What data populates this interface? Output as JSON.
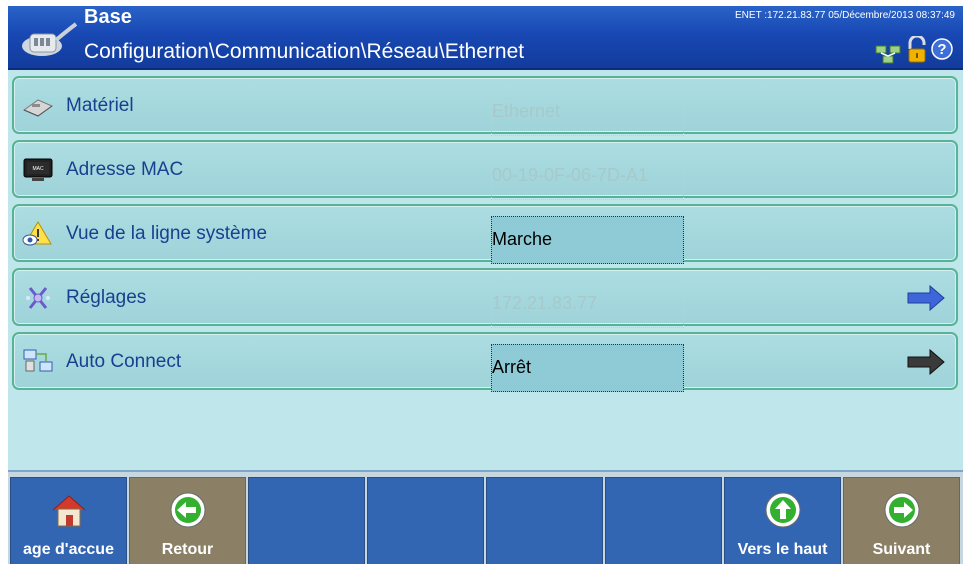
{
  "header": {
    "title": "Base",
    "path": "Configuration\\Communication\\Réseau\\Ethernet",
    "status": "ENET :172.21.83.77  05/Décembre/2013 08:37:49",
    "icons": [
      "network-icon",
      "lock-icon",
      "help-icon"
    ]
  },
  "rows": [
    {
      "label": "Matériel",
      "value": "Ethernet",
      "icon": "hardware-icon",
      "enabled": false,
      "arrow": ""
    },
    {
      "label": "Adresse MAC",
      "value": "00-19-0F-06-7D-A1",
      "icon": "mac-icon",
      "enabled": false,
      "arrow": ""
    },
    {
      "label": "Vue de la ligne système",
      "value": "Marche",
      "icon": "view-icon",
      "enabled": true,
      "arrow": ""
    },
    {
      "label": "Réglages",
      "value": "172.21.83.77",
      "icon": "settings-icon",
      "enabled": false,
      "arrow": "blue"
    },
    {
      "label": "Auto Connect",
      "value": "Arrêt",
      "icon": "autoconnect-icon",
      "enabled": true,
      "arrow": "black"
    }
  ],
  "footer": {
    "buttons": [
      {
        "label": "age d'accue",
        "icon": "home-icon"
      },
      {
        "label": "Retour",
        "icon": "back-arrow-icon"
      },
      {
        "label": "",
        "icon": ""
      },
      {
        "label": "",
        "icon": ""
      },
      {
        "label": "",
        "icon": ""
      },
      {
        "label": "",
        "icon": ""
      },
      {
        "label": "Vers le haut",
        "icon": "up-arrow-icon"
      },
      {
        "label": "Suivant",
        "icon": "next-arrow-icon"
      }
    ]
  },
  "colors": {
    "header_bg": "#1848b4",
    "row_bg": "#9ed3d9",
    "row_border": "#58b394",
    "label_text": "#1a3f8e",
    "button_blue": "#3366b2",
    "button_olive": "#8b8066"
  }
}
